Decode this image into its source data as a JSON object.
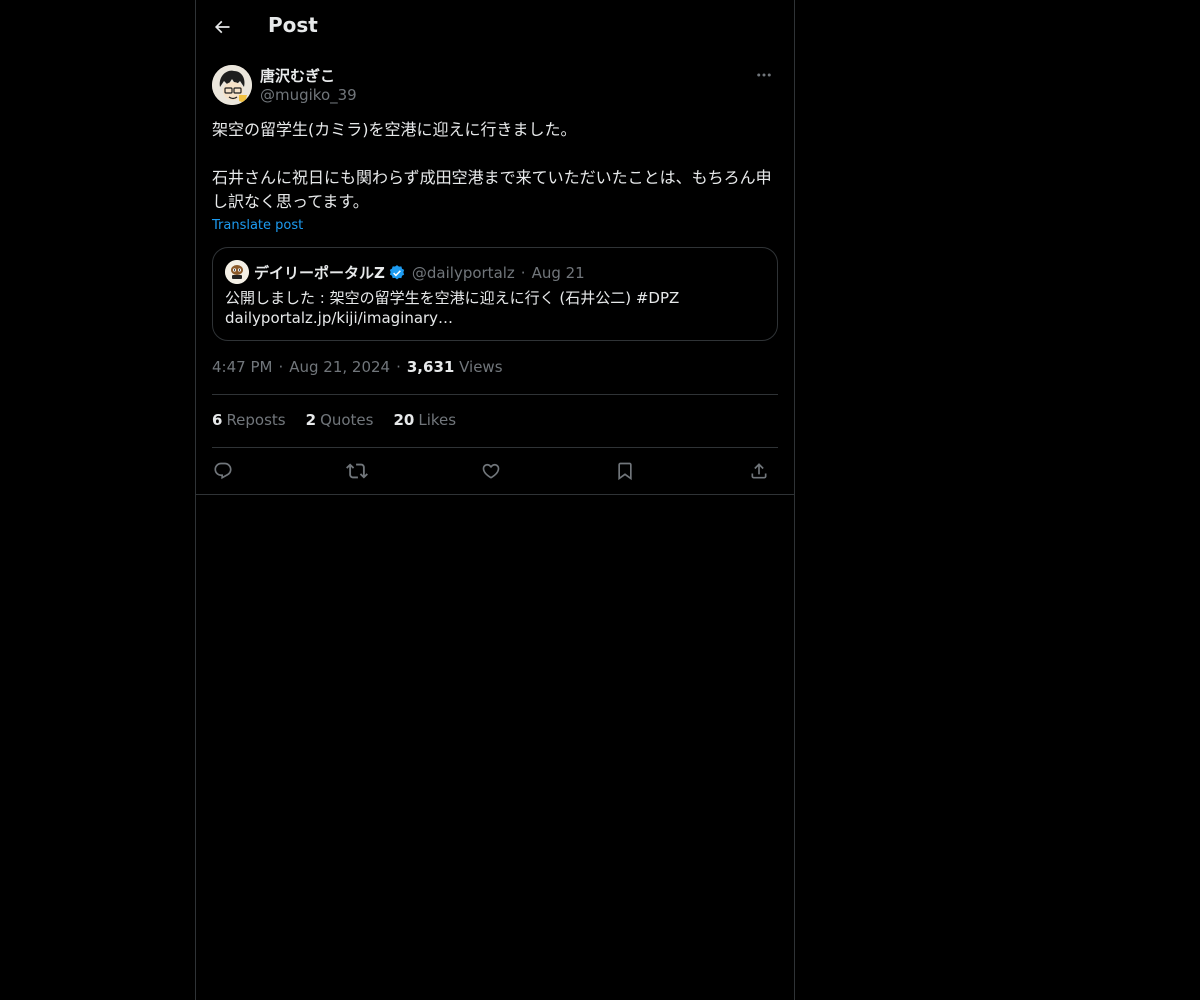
{
  "header": {
    "back_icon": "arrow-left-icon",
    "title": "Post"
  },
  "post": {
    "author": {
      "name": "唐沢むぎこ",
      "handle": "@mugiko_39",
      "avatar_icon": "avatar-illustration"
    },
    "more_icon": "more-horizontal-icon",
    "text": "架空の留学生(カミラ)を空港に迎えに行きました。\n\n石井さんに祝日にも関わらず成田空港まで来ていただいたことは、もちろん申し訳なく思ってます。",
    "translate_label": "Translate post",
    "quote": {
      "name": "デイリーポータルZ",
      "verified_icon": "verified-badge-icon",
      "handle": "@dailyportalz",
      "separator": "·",
      "date": "Aug 21",
      "text_line1": "公開しました : 架空の留学生を空港に迎えに行く (石井公二) #DPZ",
      "text_line2": "dailyportalz.jp/kiji/imaginary…"
    },
    "meta": {
      "time": "4:47 PM",
      "separator": "·",
      "date": "Aug 21, 2024",
      "views_count": "3,631",
      "views_label": "Views"
    },
    "stats": {
      "reposts_count": "6",
      "reposts_label": "Reposts",
      "quotes_count": "2",
      "quotes_label": "Quotes",
      "likes_count": "20",
      "likes_label": "Likes"
    },
    "actions": [
      "reply-icon",
      "repost-icon",
      "like-icon",
      "bookmark-icon",
      "share-icon"
    ]
  },
  "colors": {
    "background": "#000000",
    "text_primary": "#e7e9ea",
    "text_secondary": "#71767b",
    "accent": "#1d9bf0",
    "border": "#2f3336"
  }
}
